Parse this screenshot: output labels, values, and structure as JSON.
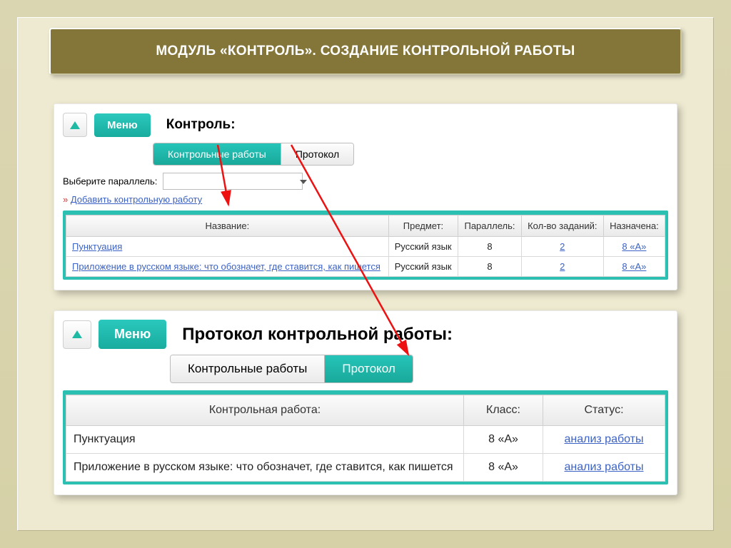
{
  "slide_title": "МОДУЛЬ «КОНТРОЛЬ». СОЗДАНИЕ КОНТРОЛЬНОЙ РАБОТЫ",
  "panel1": {
    "menu": "Меню",
    "heading": "Контроль:",
    "tab_tests": "Контрольные работы",
    "tab_protocol": "Протокол",
    "select_label": "Выберите параллель:",
    "add_link": "Добавить контрольную работу",
    "chev": "»",
    "th": {
      "name": "Название:",
      "subject": "Предмет:",
      "parallel": "Параллель:",
      "tasks": "Кол-во заданий:",
      "assigned": "Назначена:"
    },
    "rows": [
      {
        "name": "Пунктуация",
        "subject": "Русский язык",
        "parallel": "8",
        "tasks": "2",
        "assigned": "8 «А»"
      },
      {
        "name": "Приложение в русском языке: что обозначет, где ставится, как пишется",
        "subject": "Русский язык",
        "parallel": "8",
        "tasks": "2",
        "assigned": "8 «А»"
      }
    ]
  },
  "panel2": {
    "menu": "Меню",
    "heading": "Протокол контрольной работы:",
    "tab_tests": "Контрольные работы",
    "tab_protocol": "Протокол",
    "th": {
      "name": "Контрольная работа:",
      "klass": "Класс:",
      "status": "Статус:"
    },
    "rows": [
      {
        "name": "Пунктуация",
        "klass": "8 «А»",
        "status": "анализ работы"
      },
      {
        "name": "Приложение в русском языке: что обозначет, где ставится, как пишется",
        "klass": "8 «А»",
        "status": "анализ работы"
      }
    ]
  }
}
